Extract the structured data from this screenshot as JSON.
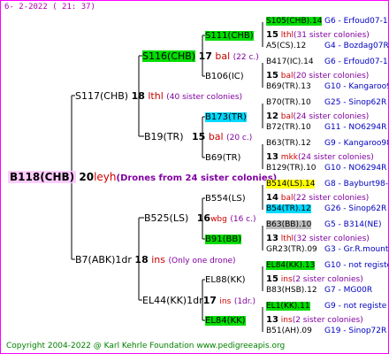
{
  "header": {
    "date": "6-  2-2022 ( 21: 37)"
  },
  "footer": {
    "copyright": "Copyright 2004-2022 @ Karl Kehrle Foundation   www.pedigreeapis.org"
  },
  "root": {
    "id": "B118(CHB)",
    "count": "20",
    "label": "leyh",
    "note": "(Drones from 24 sister colonies)"
  },
  "gen1": [
    {
      "id": "S117(CHB)",
      "count": "18",
      "label": "lthl",
      "note": "(40 sister colonies)"
    },
    {
      "id": "B7(ABK)1dr",
      "count": "18",
      "label": "ins",
      "note": "(Only one drone)"
    }
  ],
  "gen2": [
    {
      "id": "S116(CHB)",
      "count": "17",
      "label": "bal",
      "note": "(22 c.)"
    },
    {
      "id": "B19(TR)",
      "count": "15",
      "label": "bal",
      "note": "(20 c.)"
    },
    {
      "id": "B525(LS)",
      "count": "16",
      "label": "wbg",
      "note": "(16 c.)"
    },
    {
      "id": "EL44(KK)1dr",
      "count": "17",
      "label": "ins",
      "note": "(1dr.)"
    }
  ],
  "gen3": [
    {
      "id": "S111(CHB)",
      "count": "15",
      "label": "lthl",
      "note": "(31 sister colonies)"
    },
    {
      "id": "B106(IC)",
      "count": "15",
      "label": "bal",
      "note": "(20 sister colonies)"
    },
    {
      "id": "B173(TR)",
      "count": "12",
      "label": "bal",
      "note": "(24 sister colonies)"
    },
    {
      "id": "B69(TR)",
      "count": "13",
      "label": "mkk",
      "note": "(24 sister colonies)"
    },
    {
      "id": "B554(LS)",
      "count": "14",
      "label": "bal",
      "note": "(22 sister colonies)"
    },
    {
      "id": "B91(BB)",
      "count": "13",
      "label": "lthl",
      "note": "(32 sister colonies)"
    },
    {
      "id": "EL88(KK)",
      "count": "15",
      "label": "ins",
      "note": "(2 sister colonies)"
    },
    {
      "id": "EL84(KK)",
      "count": "13",
      "label": "ins",
      "note": "(2 sister colonies)"
    }
  ],
  "gen4": [
    {
      "id": "S105(CHB).14",
      "code": "G6 - Erfoud07-1Q"
    },
    {
      "id": "A5(CS).12",
      "code": "G4 - Bozdag07R"
    },
    {
      "id": "B417(IC).14",
      "code": "G6 - Erfoud07-1Q"
    },
    {
      "id": "B69(TR).13",
      "code": "G10 - Kangaroo98R"
    },
    {
      "id": "B70(TR).10",
      "code": "G25 - Sinop62R"
    },
    {
      "id": "B72(TR).10",
      "code": "G11 - NO6294R"
    },
    {
      "id": "B63(TR).12",
      "code": "G9 - Kangaroo98R"
    },
    {
      "id": "B129(TR).10",
      "code": "G10 - NO6294R"
    },
    {
      "id": "B514(LS).14",
      "code": "G8 - Bayburt98-3"
    },
    {
      "id": "B54(TR).12",
      "code": "G26 - Sinop62R"
    },
    {
      "id": "B63(BB).10",
      "code": "G5 - B314(NE)"
    },
    {
      "id": "GR23(TR).09",
      "code": "G3 - Gr.R.mounta"
    },
    {
      "id": "EL84(KK).13",
      "code": "G10 - not registe"
    },
    {
      "id": "B83(HSB).12",
      "code": "G7 - MG00R"
    },
    {
      "id": "EL1(KK).11",
      "code": "G9 - not registe"
    },
    {
      "id": "B51(AH).09",
      "code": "G19 - Sinop72R"
    }
  ]
}
